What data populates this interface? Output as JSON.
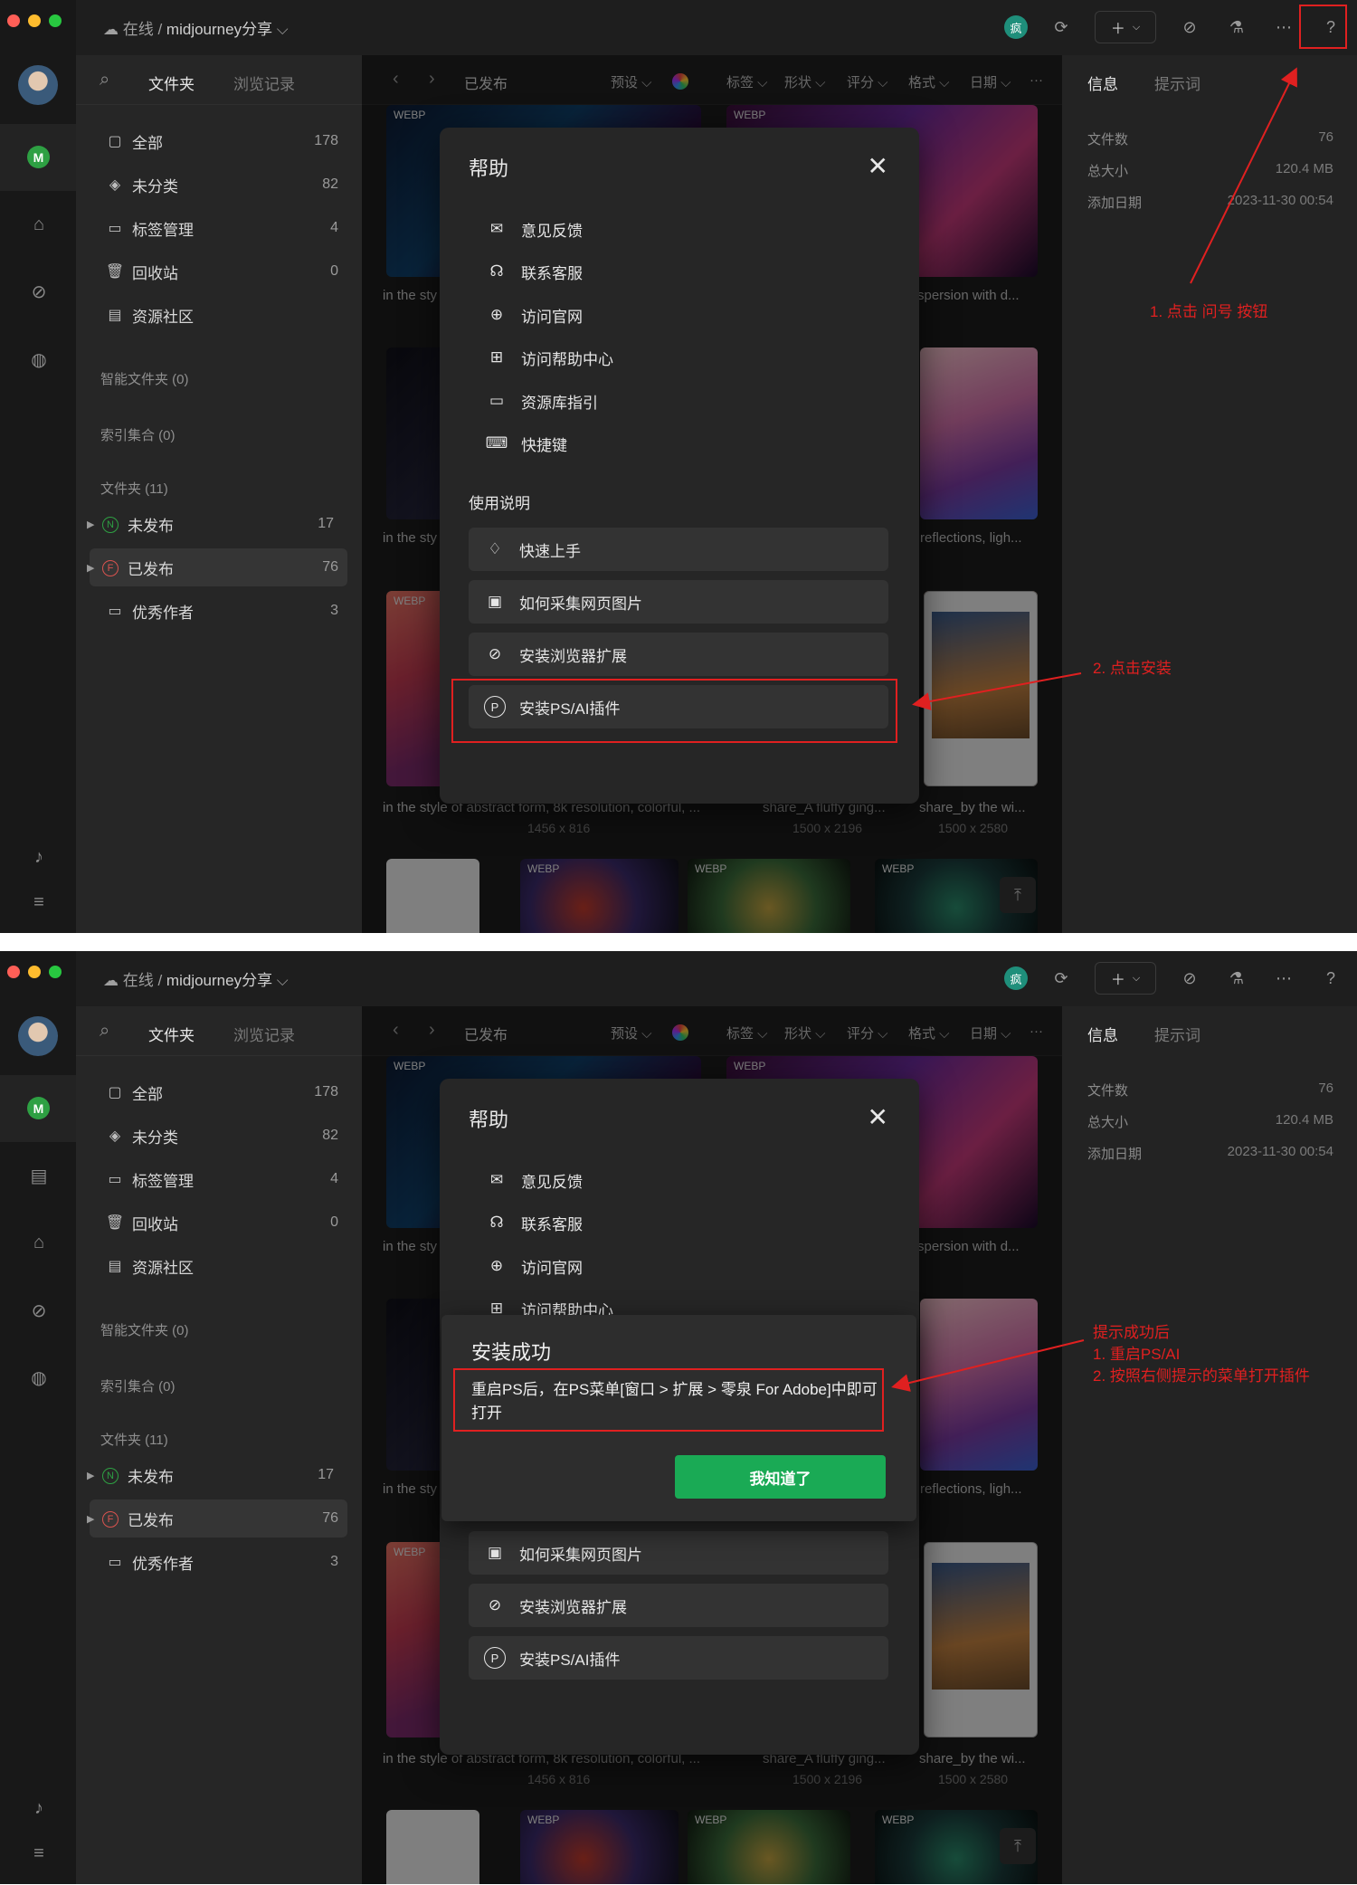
{
  "window": {
    "path_prefix": "在线 /",
    "library_name": "midjourney分享",
    "badge_text": "疯"
  },
  "sidebar": {
    "tab_folders": "文件夹",
    "tab_history": "浏览记录",
    "items": [
      {
        "label": "全部",
        "count": "178"
      },
      {
        "label": "未分类",
        "count": "82"
      },
      {
        "label": "标签管理",
        "count": "4"
      },
      {
        "label": "回收站",
        "count": "0"
      },
      {
        "label": "资源社区",
        "count": ""
      }
    ],
    "smart_folders": "智能文件夹 (0)",
    "index_sets": "索引集合 (0)",
    "folders_header": "文件夹 (11)",
    "folders": [
      {
        "badge": "N",
        "label": "未发布",
        "count": "17"
      },
      {
        "badge": "F",
        "label": "已发布",
        "count": "76"
      },
      {
        "badge": "",
        "label": "优秀作者",
        "count": "3"
      }
    ]
  },
  "toolbar": {
    "title": "已发布",
    "filters": [
      "预设",
      "标签",
      "形状",
      "评分",
      "格式",
      "日期"
    ],
    "more": "···"
  },
  "grid": {
    "webp_tag": "WEBP",
    "captions": {
      "c1": "in the style of abstract form, 8k resolution, colorful, ...",
      "c2": "share_A fluffy ging...",
      "c3": "share_by the wi...",
      "c4": "in the sty",
      "c5": "spersion with d...",
      "c6": "reflections, ligh..."
    },
    "dims": {
      "d1": "1456 x 816",
      "d2": "1500 x 2196",
      "d3": "1500 x 2580"
    }
  },
  "info_panel": {
    "tab_info": "信息",
    "tab_prompt": "提示词",
    "rows": [
      {
        "label": "文件数",
        "value": "76"
      },
      {
        "label": "总大小",
        "value": "120.4 MB"
      },
      {
        "label": "添加日期",
        "value": "2023-11-30 00:54"
      }
    ]
  },
  "help_dialog": {
    "title": "帮助",
    "items": [
      "意见反馈",
      "联系客服",
      "访问官网",
      "访问帮助中心",
      "资源库指引",
      "快捷键"
    ],
    "section": "使用说明",
    "cards": [
      "快速上手",
      "如何采集网页图片",
      "安装浏览器扩展",
      "安装PS/AI插件"
    ]
  },
  "install_popup": {
    "title": "安装成功",
    "message": "重启PS后，在PS菜单[窗口 > 扩展 > 零泉 For Adobe]中即可打开",
    "ok_button": "我知道了"
  },
  "annotations": {
    "step1": "1. 点击 问号 按钮",
    "step2": "2. 点击安装",
    "after_line1": "提示成功后",
    "after_line2": "1. 重启PS/AI",
    "after_line3": "2. 按照右侧提示的菜单打开插件"
  },
  "colors": {
    "annotation_red": "#e02020",
    "ok_green": "#1aaa55",
    "app_bg": "#1e1e1e"
  }
}
